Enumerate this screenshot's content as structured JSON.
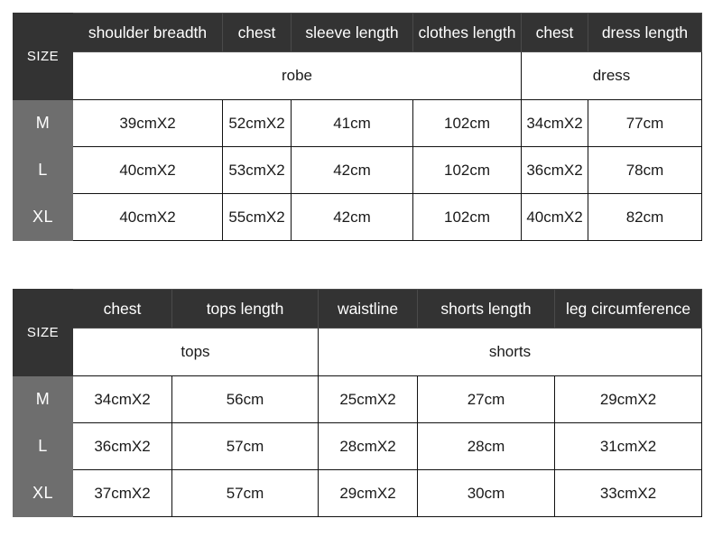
{
  "document": {
    "kind": "size-chart",
    "background_color": "#ffffff",
    "colors": {
      "header_dark": "#333333",
      "size_label_gray": "#6e6e6e",
      "cell_background": "#ffffff",
      "border": "#111111",
      "header_text": "#ffffff",
      "cell_text": "#1a1a1a"
    }
  },
  "tables": [
    {
      "id": "robe-dress",
      "size_header": "SIZE",
      "columns": [
        "shoulder breadth",
        "chest",
        "sleeve length",
        "clothes length",
        "chest",
        "dress length"
      ],
      "groups": [
        {
          "label": "robe",
          "span": 4
        },
        {
          "label": "dress",
          "span": 2
        }
      ],
      "rows": [
        {
          "size": "M",
          "values": [
            "39cmX2",
            "52cmX2",
            "41cm",
            "102cm",
            "34cmX2",
            "77cm"
          ]
        },
        {
          "size": "L",
          "values": [
            "40cmX2",
            "53cmX2",
            "42cm",
            "102cm",
            "36cmX2",
            "78cm"
          ]
        },
        {
          "size": "XL",
          "values": [
            "40cmX2",
            "55cmX2",
            "42cm",
            "102cm",
            "40cmX2",
            "82cm"
          ]
        }
      ]
    },
    {
      "id": "tops-shorts",
      "size_header": "SIZE",
      "columns": [
        "chest",
        "tops length",
        "waistline",
        "shorts length",
        "leg circumference"
      ],
      "groups": [
        {
          "label": "tops",
          "span": 2
        },
        {
          "label": "shorts",
          "span": 3
        }
      ],
      "rows": [
        {
          "size": "M",
          "values": [
            "34cmX2",
            "56cm",
            "25cmX2",
            "27cm",
            "29cmX2"
          ]
        },
        {
          "size": "L",
          "values": [
            "36cmX2",
            "57cm",
            "28cmX2",
            "28cm",
            "31cmX2"
          ]
        },
        {
          "size": "XL",
          "values": [
            "37cmX2",
            "57cm",
            "29cmX2",
            "30cm",
            "33cmX2"
          ]
        }
      ]
    }
  ]
}
